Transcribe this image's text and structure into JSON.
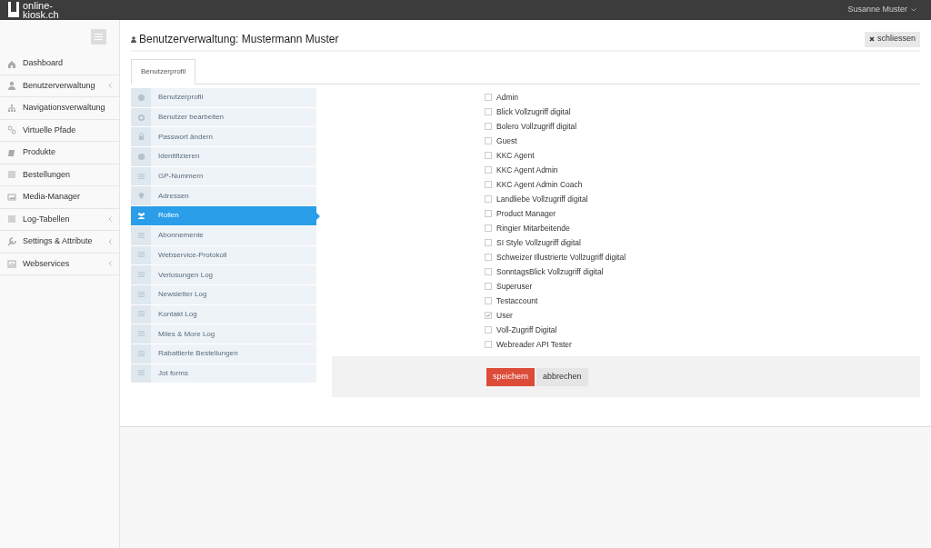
{
  "topbar": {
    "logo": "online-\nkiosk.ch",
    "user": "Susanne Muster"
  },
  "sidebar": {
    "items": [
      {
        "label": "Dashboard",
        "expandable": false
      },
      {
        "label": "Benutzerverwaltung",
        "expandable": true
      },
      {
        "label": "Navigationsverwaltung",
        "expandable": false
      },
      {
        "label": "Virtuelle Pfade",
        "expandable": false
      },
      {
        "label": "Produkte",
        "expandable": false
      },
      {
        "label": "Bestellungen",
        "expandable": false
      },
      {
        "label": "Media-Manager",
        "expandable": false
      },
      {
        "label": "Log-Tabellen",
        "expandable": true
      },
      {
        "label": "Settings & Attribute",
        "expandable": true
      },
      {
        "label": "Webservices",
        "expandable": true
      }
    ]
  },
  "page": {
    "title": "Benutzerverwaltung: Mustermann Muster",
    "close_button": "schliessen"
  },
  "tabs": [
    {
      "label": "Benutzerprofil",
      "selected": true
    }
  ],
  "submenu": [
    {
      "label": "Benutzerprofil",
      "selected": false
    },
    {
      "label": "Benutzer bearbeiten",
      "selected": false
    },
    {
      "label": "Passwort ändern",
      "selected": false
    },
    {
      "label": "Identifizieren",
      "selected": false
    },
    {
      "label": "GP-Nummern",
      "selected": false
    },
    {
      "label": "Adressen",
      "selected": false
    },
    {
      "label": "Rollen",
      "selected": true
    },
    {
      "label": "Abonnemente",
      "selected": false
    },
    {
      "label": "Webservice-Protokoll",
      "selected": false
    },
    {
      "label": "Verlosungen Log",
      "selected": false
    },
    {
      "label": "Newsletter Log",
      "selected": false
    },
    {
      "label": "Kontakt Log",
      "selected": false
    },
    {
      "label": "Miles & More Log",
      "selected": false
    },
    {
      "label": "Rabattierte Bestellungen",
      "selected": false
    },
    {
      "label": "Jot forms",
      "selected": false
    }
  ],
  "roles": [
    {
      "label": "Admin",
      "checked": false
    },
    {
      "label": "Blick Vollzugriff digital",
      "checked": false
    },
    {
      "label": "Bolero Vollzugriff digital",
      "checked": false
    },
    {
      "label": "Guest",
      "checked": false
    },
    {
      "label": "KKC Agent",
      "checked": false
    },
    {
      "label": "KKC Agent Admin",
      "checked": false
    },
    {
      "label": "KKC Agent Admin Coach",
      "checked": false
    },
    {
      "label": "Landliebe Vollzugriff digital",
      "checked": false
    },
    {
      "label": "Product Manager",
      "checked": false
    },
    {
      "label": "Ringier Mitarbeitende",
      "checked": false
    },
    {
      "label": "SI Style Vollzugriff digital",
      "checked": false
    },
    {
      "label": "Schweizer Illustrierte Vollzugriff digital",
      "checked": false
    },
    {
      "label": "SonntagsBlick Vollzugriff digital",
      "checked": false
    },
    {
      "label": "Superuser",
      "checked": false
    },
    {
      "label": "Testaccount",
      "checked": false
    },
    {
      "label": "User",
      "checked": true
    },
    {
      "label": "Voll-Zugriff Digital",
      "checked": false
    },
    {
      "label": "Webreader API Tester",
      "checked": false
    }
  ],
  "actions": {
    "save": "speichern",
    "cancel": "abbrechen"
  }
}
